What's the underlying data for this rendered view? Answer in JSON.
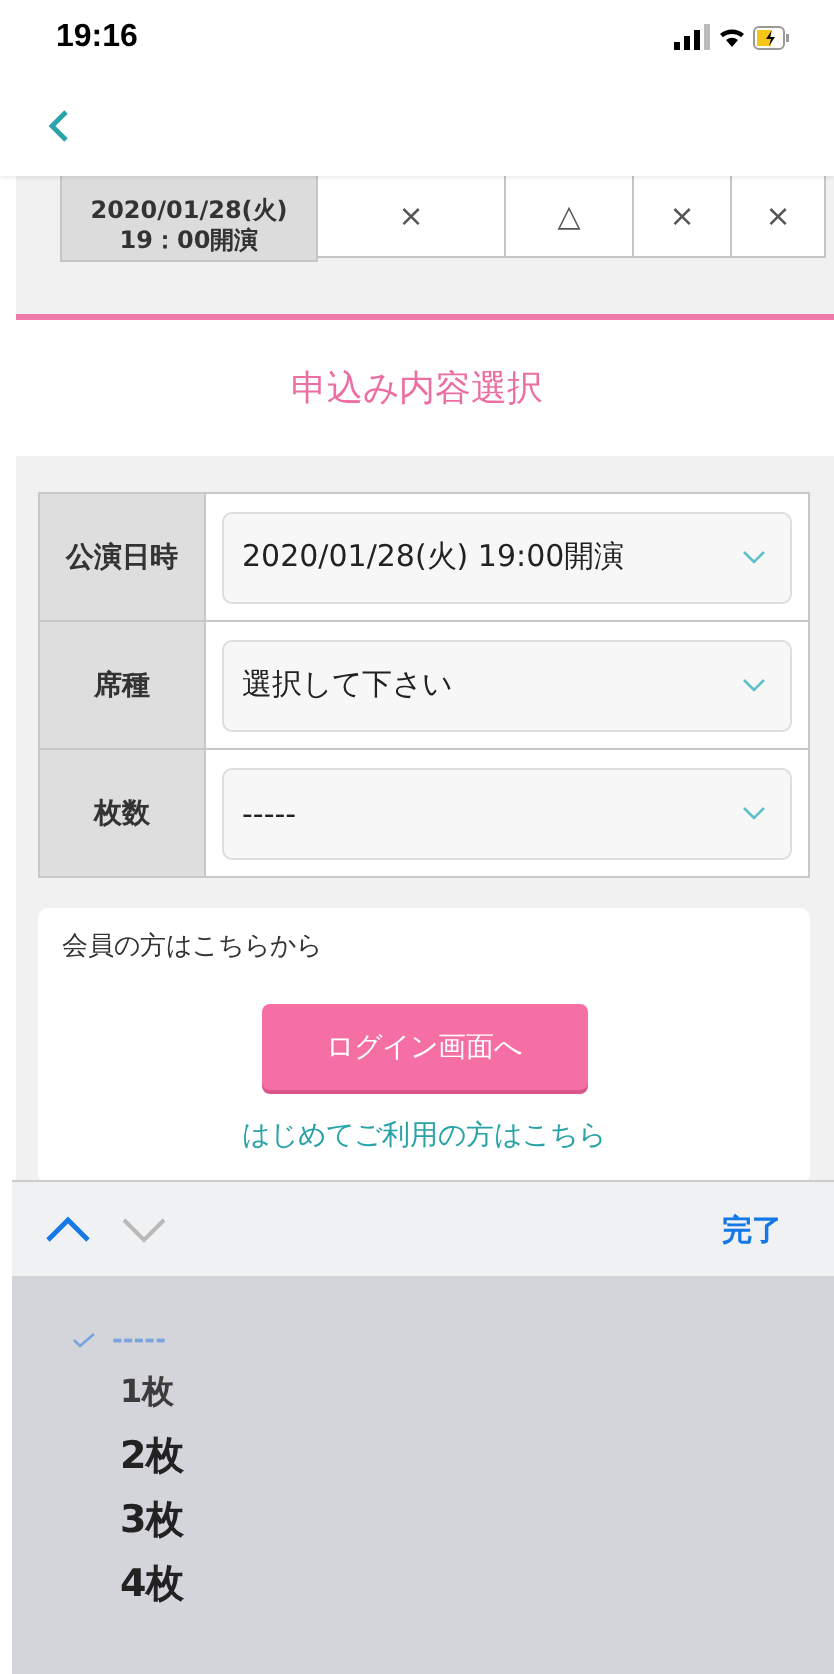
{
  "status_bar": {
    "time": "19:16"
  },
  "schedule_row": {
    "date": "2020/01/28(火)",
    "time": "19：00開演",
    "marks": [
      "×",
      "△",
      "×",
      "×"
    ]
  },
  "section_title": "申込み内容選択",
  "form": [
    {
      "label": "公演日時",
      "value": "2020/01/28(火) 19:00開演"
    },
    {
      "label": "席種",
      "value": "選択して下さい"
    },
    {
      "label": "枚数",
      "value": "-----"
    }
  ],
  "member": {
    "text": "会員の方はこちらから",
    "button": "ログイン画面へ",
    "link": "はじめてご利用の方はこちら"
  },
  "keyboard_bar": {
    "done": "完了"
  },
  "picker": [
    {
      "label": "-----",
      "selected": true
    },
    {
      "label": "1枚",
      "selected": false
    },
    {
      "label": "2枚",
      "selected": false
    },
    {
      "label": "3枚",
      "selected": false
    },
    {
      "label": "4枚",
      "selected": false
    }
  ]
}
